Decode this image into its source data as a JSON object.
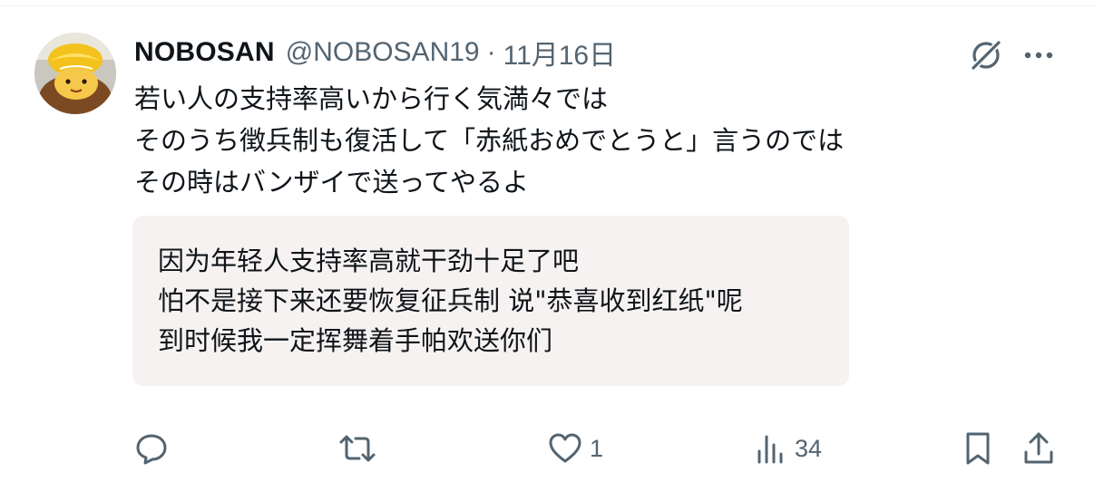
{
  "post": {
    "author": {
      "display_name": "NOBOSAN",
      "handle": "@NOBOSAN19",
      "separator": "·",
      "date": "11月16日"
    },
    "text_lines": [
      "若い人の支持率高いから行く気満々では",
      "そのうち徴兵制も復活して「赤紙おめでとうと」言うのでは",
      "その時はバンザイで送ってやるよ"
    ],
    "translation_lines": [
      "因为年轻人支持率高就干劲十足了吧",
      "怕不是接下来还要恢复征兵制 说\"恭喜收到红纸\"呢",
      "到时候我一定挥舞着手帕欢送你们"
    ]
  },
  "actions": {
    "reply": {
      "icon": "reply-icon",
      "count": ""
    },
    "repost": {
      "icon": "repost-icon",
      "count": ""
    },
    "like": {
      "icon": "heart-icon",
      "count": "1"
    },
    "views": {
      "icon": "analytics-icon",
      "count": "34"
    },
    "bookmark": {
      "icon": "bookmark-icon"
    },
    "share": {
      "icon": "share-icon"
    }
  },
  "colors": {
    "text": "#0f1419",
    "secondary": "#536471",
    "card_bg": "#f7f2f2"
  }
}
